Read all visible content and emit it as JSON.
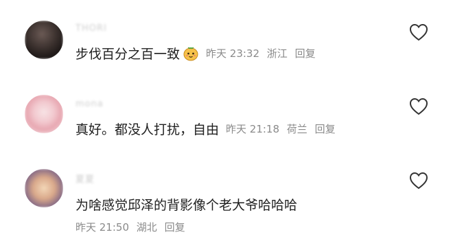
{
  "comments": [
    {
      "username": "THORI",
      "text": "步伐百分之百一致",
      "emoji": "smiling-face-emoji",
      "time": "昨天 23:32",
      "location": "浙江",
      "reply_label": "回复",
      "like_icon": "heart-outline-icon"
    },
    {
      "username": "mona",
      "text": "真好。都没人打扰，自由",
      "time": "昨天 21:18",
      "location": "荷兰",
      "reply_label": "回复",
      "like_icon": "heart-outline-icon"
    },
    {
      "username": "夏夏",
      "text": "为啥感觉邱泽的背影像个老大爷哈哈哈",
      "time": "昨天 21:50",
      "location": "湖北",
      "reply_label": "回复",
      "like_icon": "heart-outline-icon"
    }
  ],
  "colors": {
    "meta_text": "#8a8a8a",
    "content_text": "#1f1f1f",
    "username_text": "#cfcfcf"
  }
}
